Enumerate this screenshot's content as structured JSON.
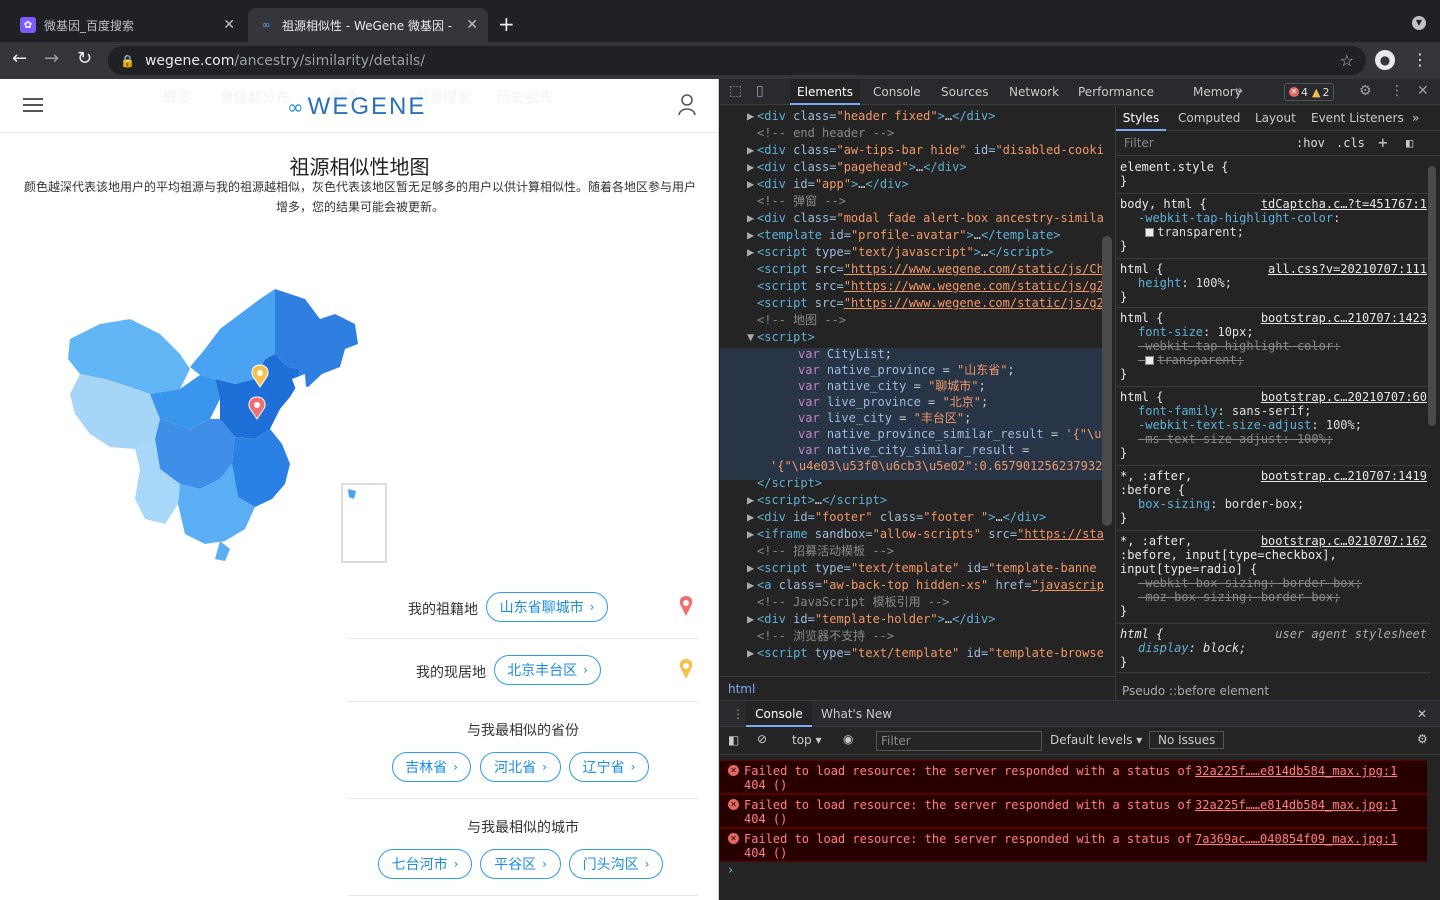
{
  "browser": {
    "tabs": [
      {
        "title": "微基因_百度搜索",
        "active": false
      },
      {
        "title": "祖源相似性 - WeGene 微基因 - ",
        "active": true
      }
    ],
    "url_host": "wegene.com",
    "url_path": "/ancestry/similarity/details/"
  },
  "page": {
    "ghost_nav": [
      "概览",
      "单倍群分布",
      "祖源",
      "祖源搜索",
      "历史祖先"
    ],
    "logo_text": "WEGENE",
    "title": "祖源相似性地图",
    "description": "颜色越深代表该地用户的平均祖源与我的祖源越相似，灰色代表该地区暂无足够多的用户以供计算相似性。随着各地区参与用户增多，您的结果可能会被更新。",
    "native_label": "我的祖籍地",
    "native_value": "山东省聊城市",
    "live_label": "我的现居地",
    "live_value": "北京丰台区",
    "similar_provinces_title": "与我最相似的省份",
    "similar_provinces": [
      "吉林省",
      "河北省",
      "辽宁省"
    ],
    "similar_cities_title": "与我最相似的城市",
    "similar_cities": [
      "七台河市",
      "平谷区",
      "门头沟区"
    ],
    "colors": {
      "accent": "#1a8de0",
      "pin_native": "#f06f73",
      "pin_live": "#f6c04a"
    }
  },
  "devtools": {
    "tabs": [
      "Elements",
      "Console",
      "Sources",
      "Network",
      "Performance",
      "Memory"
    ],
    "active_tab": "Elements",
    "error_count": "4",
    "warning_count": "2",
    "breadcrumb": "html",
    "style_tabs": [
      "Styles",
      "Computed",
      "Layout",
      "Event Listeners"
    ],
    "style_filter_placeholder": "Filter",
    "hov": ":hov",
    "cls": ".cls",
    "pseudo_label": "Pseudo ::before element",
    "drawer_tabs": [
      "Console",
      "What's New"
    ],
    "console_context": "top",
    "console_filter_placeholder": "Filter",
    "default_levels": "Default levels",
    "no_issues": "No Issues",
    "console_messages": [
      {
        "text": "Failed to load resource: the server responded with a status of 404 ()",
        "source": "32a225f……e814db584_max.jpg:1"
      },
      {
        "text": "Failed to load resource: the server responded with a status of 404 ()",
        "source": "32a225f……e814db584_max.jpg:1"
      },
      {
        "text": "Failed to load resource: the server responded with a status of 404 ()",
        "source": "7a369ac……040854f09_max.jpg:1"
      }
    ]
  }
}
